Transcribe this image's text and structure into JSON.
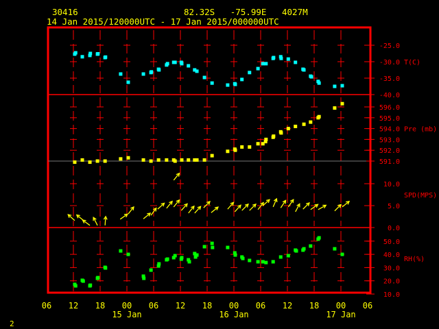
{
  "header": {
    "station": "30416",
    "location": "82.32S   -75.99E   4027M",
    "period": "14 Jan 2015/120000UTC - 17 Jan 2015/000000UTC"
  },
  "page_number": "2",
  "colors": {
    "frame": "#ff0000",
    "text": "#ffff00",
    "temp": "#00ffff",
    "pres": "#ffff00",
    "wind": "#ffff00",
    "rh": "#00ff00"
  },
  "chart_data": {
    "type": "scatter",
    "x_axis": {
      "units": "hours since 14 Jan 06UTC",
      "range": [
        0,
        72
      ],
      "tick_labels": [
        "06",
        "12",
        "18",
        "00",
        "06",
        "12",
        "18",
        "00",
        "06",
        "12",
        "18",
        "00",
        "06"
      ],
      "day_labels": [
        {
          "label": "15 Jan",
          "hour": 18
        },
        {
          "label": "16 Jan",
          "hour": 42
        },
        {
          "label": "17 Jan",
          "hour": 66
        }
      ]
    },
    "panels": [
      {
        "name": "temperature",
        "label": "T(C)",
        "ticks": [
          "-25.0",
          "-30.0",
          "-35.0",
          "-40.0"
        ],
        "tick_values": [
          -25,
          -30,
          -35,
          -40
        ],
        "range": [
          -40,
          -20.5
        ],
        "points": [
          [
            6.3,
            -27.7
          ],
          [
            6.5,
            -27.3
          ],
          [
            8,
            -28.5
          ],
          [
            9.7,
            -28.1
          ],
          [
            9.8,
            -27.5
          ],
          [
            11.4,
            -27.7
          ],
          [
            11.5,
            -27.6
          ],
          [
            13.1,
            -28.75
          ],
          [
            13.2,
            -28.6
          ],
          [
            16.6,
            -33.75
          ],
          [
            18.3,
            -36.25
          ],
          [
            21.7,
            -33.75
          ],
          [
            23.4,
            -33.3
          ],
          [
            23.5,
            -33.1
          ],
          [
            25.1,
            -32.3
          ],
          [
            25.2,
            -32.5
          ],
          [
            26.9,
            -31
          ],
          [
            27.1,
            -30.6
          ],
          [
            28.5,
            -30.2
          ],
          [
            28.8,
            -30.2
          ],
          [
            30.2,
            -30.2
          ],
          [
            30.3,
            -30.6
          ],
          [
            31.8,
            -31.25
          ],
          [
            33.2,
            -32.5
          ],
          [
            33.7,
            -32.9
          ],
          [
            35.4,
            -34.8
          ],
          [
            37.1,
            -36.5
          ],
          [
            40.6,
            -37.1
          ],
          [
            42.2,
            -36.7
          ],
          [
            42.3,
            -36.9
          ],
          [
            43.8,
            -35.4
          ],
          [
            45.5,
            -33.3
          ],
          [
            47.4,
            -32.1
          ],
          [
            48.5,
            -30.6
          ],
          [
            49.2,
            -30.6
          ],
          [
            50.8,
            -29
          ],
          [
            50.9,
            -28.75
          ],
          [
            52.5,
            -28.5
          ],
          [
            52.6,
            -29
          ],
          [
            54.2,
            -29.2
          ],
          [
            55.8,
            -30.2
          ],
          [
            57.5,
            -32.3
          ],
          [
            57.7,
            -32.5
          ],
          [
            59.2,
            -34.4
          ],
          [
            59.4,
            -34.6
          ],
          [
            60.9,
            -36
          ],
          [
            61.1,
            -36.5
          ],
          [
            64.6,
            -37.5
          ],
          [
            66.3,
            -37.3
          ]
        ]
      },
      {
        "name": "pressure",
        "label": "Pre (mb)",
        "ticks": [
          "596.0",
          "595.0",
          "594.0",
          "593.0",
          "592.0",
          "591.0"
        ],
        "tick_values": [
          596,
          595,
          594,
          593,
          592,
          591
        ],
        "range": [
          591,
          597.2
        ],
        "points": [
          [
            6.3,
            590.9
          ],
          [
            8,
            591.1
          ],
          [
            9.7,
            590.9
          ],
          [
            11.4,
            591
          ],
          [
            13.1,
            591
          ],
          [
            16.6,
            591.2
          ],
          [
            18.3,
            591.3
          ],
          [
            21.7,
            591.1
          ],
          [
            23.4,
            591
          ],
          [
            25.1,
            591.1
          ],
          [
            26.9,
            591.1
          ],
          [
            28.5,
            591.1
          ],
          [
            28.8,
            591
          ],
          [
            30.3,
            591.1
          ],
          [
            31.8,
            591.1
          ],
          [
            33.2,
            591.1
          ],
          [
            33.7,
            591.1
          ],
          [
            35.4,
            591.1
          ],
          [
            37.1,
            591.5
          ],
          [
            40.6,
            591.9
          ],
          [
            42.2,
            592.1
          ],
          [
            42.3,
            592
          ],
          [
            43.8,
            592.3
          ],
          [
            45.5,
            592.3
          ],
          [
            47.4,
            592.6
          ],
          [
            48.5,
            592.6
          ],
          [
            49.1,
            592.8
          ],
          [
            49.2,
            593
          ],
          [
            50.8,
            593.2
          ],
          [
            50.9,
            593.3
          ],
          [
            52.5,
            593.7
          ],
          [
            52.6,
            593.6
          ],
          [
            54.2,
            594
          ],
          [
            55.8,
            594.2
          ],
          [
            57.7,
            594.4
          ],
          [
            59.2,
            594.6
          ],
          [
            60.9,
            595
          ],
          [
            61.1,
            595.1
          ],
          [
            64.6,
            595.9
          ],
          [
            66.3,
            596.3
          ]
        ]
      },
      {
        "name": "wind_speed",
        "label": "SPD(MPS)",
        "ticks": [
          "10.0",
          "5.0",
          "0.0"
        ],
        "tick_values": [
          10,
          5,
          0
        ],
        "range": [
          0,
          14.5
        ],
        "points": [
          [
            6.3,
            1.6,
            312
          ],
          [
            8.3,
            1.6,
            309
          ],
          [
            9.7,
            0.5,
            306
          ],
          [
            11.4,
            0.5,
            333
          ],
          [
            13.1,
            0.5,
            4
          ],
          [
            16.5,
            1.9,
            55
          ],
          [
            18.3,
            3.1,
            38
          ],
          [
            21.7,
            2,
            51
          ],
          [
            23.4,
            2.8,
            36
          ],
          [
            24.9,
            4.2,
            48
          ],
          [
            26.9,
            4.4,
            39
          ],
          [
            28.5,
            4.7,
            39
          ],
          [
            28.5,
            10.8,
            39
          ],
          [
            30.2,
            3.9,
            42
          ],
          [
            31.8,
            3.3,
            39
          ],
          [
            33.2,
            3.3,
            42
          ],
          [
            35.2,
            4.5,
            45
          ],
          [
            36.9,
            3.4,
            51
          ],
          [
            40.6,
            4.2,
            41
          ],
          [
            42.2,
            3.6,
            42
          ],
          [
            43.8,
            3.9,
            45
          ],
          [
            45.5,
            3.9,
            45
          ],
          [
            47.4,
            4.1,
            38
          ],
          [
            48.5,
            5,
            48
          ],
          [
            50.8,
            4.7,
            23
          ],
          [
            52.5,
            4.5,
            34
          ],
          [
            54.2,
            4.7,
            35
          ],
          [
            55.8,
            3.6,
            28
          ],
          [
            57.5,
            4.2,
            45
          ],
          [
            59.2,
            4.1,
            55
          ],
          [
            60.9,
            4.1,
            61
          ],
          [
            64.6,
            3.8,
            45
          ],
          [
            66.3,
            4.7,
            51
          ]
        ]
      },
      {
        "name": "relative_humidity",
        "label": "RH(%)",
        "ticks": [
          "50.0",
          "40.0",
          "30.0",
          "20.0",
          "10.0"
        ],
        "tick_values": [
          50,
          40,
          30,
          20,
          10
        ],
        "range": [
          10,
          60
        ],
        "points": [
          [
            6.3,
            17.3
          ],
          [
            6.5,
            16.2
          ],
          [
            8,
            20.4
          ],
          [
            8.2,
            19.8
          ],
          [
            9.7,
            16.2
          ],
          [
            9.8,
            16.7
          ],
          [
            11.4,
            21.9
          ],
          [
            11.5,
            22.4
          ],
          [
            13.1,
            30.2
          ],
          [
            13.2,
            29.7
          ],
          [
            16.6,
            42.6
          ],
          [
            18.3,
            40
          ],
          [
            21.7,
            23.5
          ],
          [
            21.8,
            21.9
          ],
          [
            23.4,
            28.1
          ],
          [
            25.1,
            31.2
          ],
          [
            25.2,
            32.8
          ],
          [
            26.9,
            35.9
          ],
          [
            27.1,
            36.4
          ],
          [
            28.5,
            37.5
          ],
          [
            28.8,
            39
          ],
          [
            30.2,
            36.4
          ],
          [
            30.3,
            37.5
          ],
          [
            31.8,
            35.9
          ],
          [
            32,
            34.4
          ],
          [
            33.2,
            40.6
          ],
          [
            33.4,
            38
          ],
          [
            33.7,
            39.5
          ],
          [
            35.4,
            45.8
          ],
          [
            37.1,
            48.3
          ],
          [
            37.2,
            45.2
          ],
          [
            40.6,
            45.2
          ],
          [
            42.2,
            41.1
          ],
          [
            42.3,
            39.5
          ],
          [
            43.8,
            38
          ],
          [
            44,
            36.9
          ],
          [
            45.5,
            35.4
          ],
          [
            47.4,
            34.4
          ],
          [
            48.5,
            34.4
          ],
          [
            49.2,
            33.8
          ],
          [
            50.8,
            34.4
          ],
          [
            52.5,
            38
          ],
          [
            54.2,
            39
          ],
          [
            55.8,
            43.2
          ],
          [
            56,
            42.6
          ],
          [
            57.5,
            43.2
          ],
          [
            57.7,
            44.2
          ],
          [
            59.2,
            46.3
          ],
          [
            60.9,
            51.5
          ],
          [
            61.1,
            52.5
          ],
          [
            64.6,
            44.2
          ],
          [
            66.3,
            40
          ]
        ]
      }
    ]
  }
}
